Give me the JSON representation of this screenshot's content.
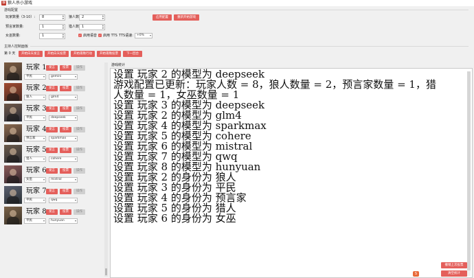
{
  "window": {
    "title": "狼人杀小游戏",
    "icon": "app-icon"
  },
  "config": {
    "group_title": "游戏配置",
    "player_count_label": "玩家数量（3-10）:",
    "player_count": "8",
    "werewolf_count_label": "狼人数量:",
    "werewolf_count": "2",
    "seer_count_label": "预言家数量:",
    "seer_count": "1",
    "hunter_count_label": "猎人数量:",
    "hunter_count": "1",
    "witch_count_label": "女巫数量:",
    "witch_count": "1",
    "apply_button": "应用配置",
    "restart_button": "重新开始游戏",
    "voice_label": "启用语音",
    "tts_label": "启用 TTS",
    "tts_speed_label": "TTS语速:",
    "tts_speed": "+0%"
  },
  "host": {
    "group_title": "主持人控制面板",
    "day": "第 0 天",
    "buttons": [
      "开始白天发言",
      "开始白天投票",
      "开始夜晚行动",
      "开始夜晚投票",
      "下一回合"
    ]
  },
  "stats_label": "游戏统计",
  "players": [
    {
      "name": "玩家",
      "index": "1",
      "role": "平民",
      "model": "gemini"
    },
    {
      "name": "玩家",
      "index": "2",
      "role": "狼人",
      "model": "glm4"
    },
    {
      "name": "玩家",
      "index": "3",
      "role": "平民",
      "model": "deepseek"
    },
    {
      "name": "玩家",
      "index": "4",
      "role": "预言家",
      "model": "sparkmax"
    },
    {
      "name": "玩家",
      "index": "5",
      "role": "猎人",
      "model": "cohere"
    },
    {
      "name": "玩家",
      "index": "6",
      "role": "女巫",
      "model": "mistral"
    },
    {
      "name": "玩家",
      "index": "7",
      "role": "平民",
      "model": "qwq"
    },
    {
      "name": "玩家",
      "index": "8",
      "role": "平民",
      "model": "hunyuan"
    }
  ],
  "player_buttons": {
    "speak": "发言",
    "vote": "投票",
    "action": "操作"
  },
  "log": [
    "设置 玩家 2 的模型为 deepseek",
    "游戏配置已更新：玩家人数 = 8，狼人数量 = 2，预言家数量 = 1，猎人数量 = 1，女巫数量 = 1",
    "设置 玩家 3 的模型为 deepseek",
    "设置 玩家 2 的模型为 glm4",
    "设置 玩家 4 的模型为 sparkmax",
    "设置 玩家 5 的模型为 cohere",
    "设置 玩家 6 的模型为 mistral",
    "设置 玩家 7 的模型为 qwq",
    "设置 玩家 8 的模型为 hunyuan",
    "设置 玩家 2 的身份为 狼人",
    "设置 玩家 3 的身份为 平民",
    "设置 玩家 4 的身份为 预言家",
    "设置 玩家 5 的身份为 猎人",
    "设置 玩家 6 的身份为 女巫"
  ],
  "bottom_buttons": {
    "undo_vote": "撤销上次投票",
    "clear": "清空统计"
  },
  "colors": {
    "accent": "#e45f5b"
  }
}
